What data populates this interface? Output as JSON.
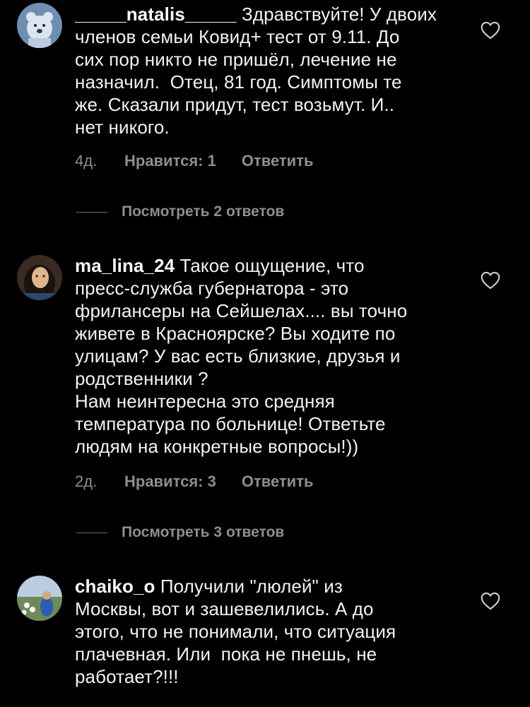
{
  "comments": [
    {
      "username": "_____natalis_____",
      "text": "Здравствуйте! У двоих\nчленов семьи Ковид+ тест от 9.11. До\nсих пор никто не пришёл, лечение не\nназначил.  Отец, 81 год. Симптомы те\nже. Сказали придут, тест возьмут. И..\nнет никого.",
      "time": "4д.",
      "likes": "Нравится: 1",
      "reply": "Ответить",
      "view_replies": "Посмотреть 2 ответов"
    },
    {
      "username": "ma_lina_24",
      "text": "Такое ощущение, что\nпресс-служба губернатора - это\nфрилансеры на Сейшелах.... вы точно\nживете в Красноярске? Вы ходите по\nулицам? У вас есть близкие, друзья и\nродственники ?\nНам неинтересна это средняя\nтемпература по больнице! Ответьте\nлюдям на конкретные вопросы!))",
      "time": "2д.",
      "likes": "Нравится: 3",
      "reply": "Ответить",
      "view_replies": "Посмотреть 3 ответов"
    },
    {
      "username": "chaiko_o",
      "text": "Получили \"люлей\" из\nМосквы, вот и зашевелились. А до\nэтого, что не понимали, что ситуация\nплачевная. Или  пока не пнешь, не\nработает?!!!"
    }
  ],
  "colors": {
    "background": "#000000",
    "text": "#f2f2f2",
    "secondary": "#8e8e8e"
  },
  "icons": {
    "like": "heart-outline-icon"
  }
}
